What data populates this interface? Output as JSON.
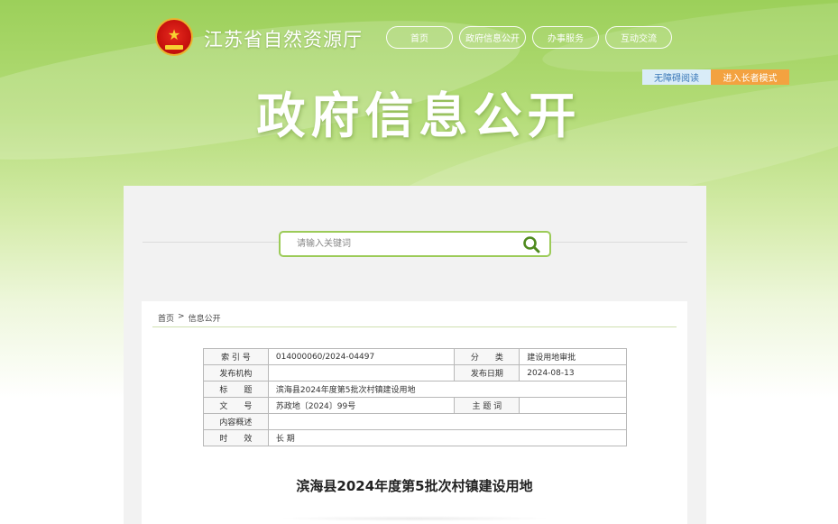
{
  "header": {
    "site_name": "江苏省自然资源厅",
    "nav": [
      "首页",
      "政府信息公开",
      "办事服务",
      "互动交流"
    ],
    "accessible_label": "无障碍阅读",
    "elder_label": "进入长者模式",
    "hero_title": "政府信息公开"
  },
  "search": {
    "placeholder": "请输入关键词",
    "icon": "search-icon"
  },
  "breadcrumb": {
    "home": "首页",
    "separator": ">",
    "current": "信息公开"
  },
  "meta": {
    "index_label": "索 引 号",
    "index_value": "014000060/2024-04497",
    "category_label": "分　　类",
    "category_value": "建设用地审批",
    "org_label": "发布机构",
    "org_value": "",
    "date_label": "发布日期",
    "date_value": "2024-08-13",
    "title_label": "标　　题",
    "title_value": "滨海县2024年度第5批次村镇建设用地",
    "docno_label": "文　　号",
    "docno_value": "苏政地〔2024〕99号",
    "keywords_label": "主 题 词",
    "keywords_value": "",
    "summary_label": "内容概述",
    "summary_value": "",
    "validity_label": "时　　效",
    "validity_value": "长 期"
  },
  "document": {
    "title": "滨海县2024年度第5批次村镇建设用地"
  },
  "colors": {
    "accent_green": "#9ccb58",
    "elder_orange": "#f3a240",
    "accessible_blue": "#d9ecf8"
  }
}
